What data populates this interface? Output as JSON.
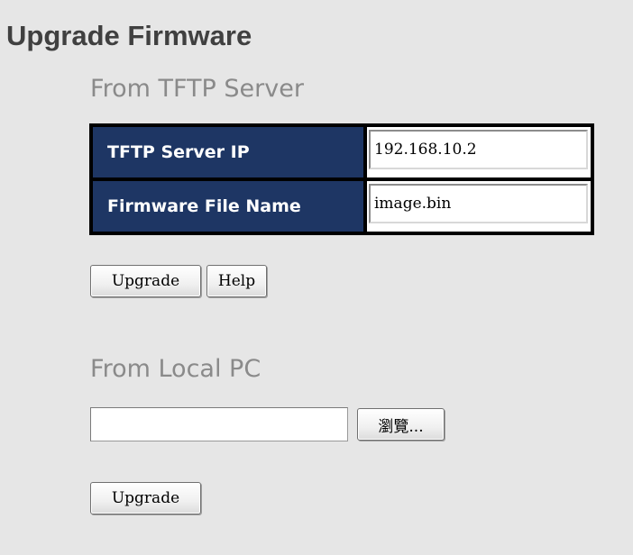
{
  "page": {
    "title": "Upgrade Firmware"
  },
  "tftp": {
    "heading": "From TFTP Server",
    "server_ip_label": "TFTP Server IP",
    "server_ip_value": "192.168.10.2",
    "file_name_label": "Firmware File Name",
    "file_name_value": "image.bin",
    "upgrade_label": "Upgrade",
    "help_label": "Help"
  },
  "local": {
    "heading": "From Local PC",
    "file_path_value": "",
    "browse_label": "瀏覽...",
    "upgrade_label": "Upgrade"
  },
  "colors": {
    "page_background": "#e6e6e6",
    "table_label_background": "#1e3664",
    "table_border": "#000000",
    "title_text": "#404040",
    "section_heading_text": "#8a8a8a"
  }
}
